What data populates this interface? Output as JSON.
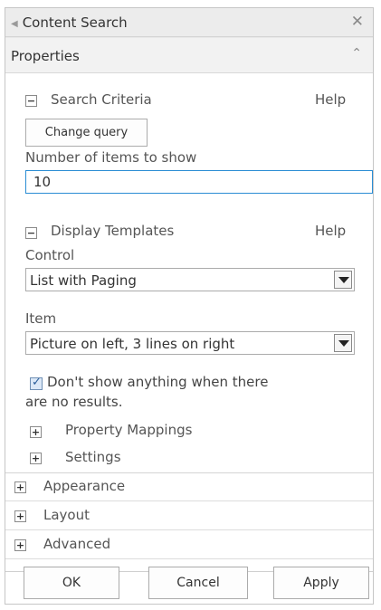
{
  "title_bar": {
    "title": "Content Search",
    "close_glyph": "✕"
  },
  "properties": {
    "title": "Properties",
    "collapse_glyph": "˄"
  },
  "search_criteria": {
    "toggle": "−",
    "title": "Search Criteria",
    "help": "Help",
    "change_query": "Change query",
    "items_label": "Number of items to show",
    "items_value": "10"
  },
  "display_templates": {
    "toggle": "−",
    "title": "Display Templates",
    "help": "Help",
    "control_label": "Control",
    "control_value": "List with Paging",
    "item_label": "Item",
    "item_value": "Picture on left, 3 lines on right",
    "checkbox_line1": "Don't show anything when there",
    "checkbox_line2": "are no results.",
    "checkbox_checked": true,
    "property_mappings": "Property Mappings",
    "settings": "Settings"
  },
  "groups": {
    "appearance": "Appearance",
    "layout": "Layout",
    "advanced": "Advanced"
  },
  "footer": {
    "ok": "OK",
    "cancel": "Cancel",
    "apply": "Apply"
  },
  "colors": {
    "link": "#1d6fc2",
    "input_border": "#2a8dd4",
    "panel_border": "#c6c6c6"
  }
}
